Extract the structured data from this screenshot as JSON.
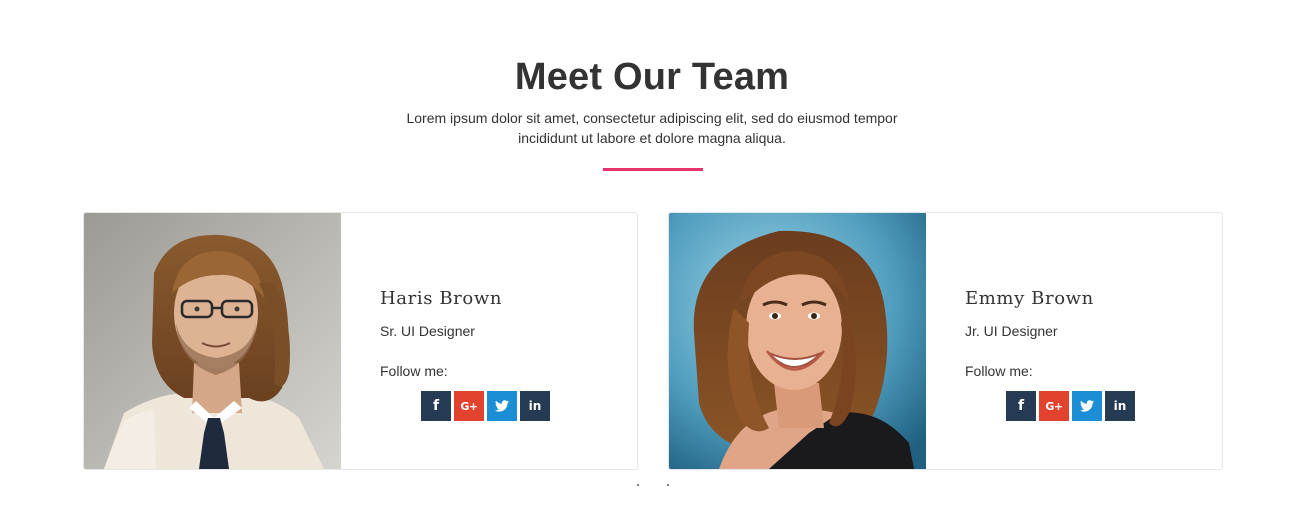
{
  "header": {
    "title": "Meet Our Team",
    "subtitle_line1": "Lorem ipsum dolor sit amet, consectetur adipiscing elit, sed do eiusmod tempor",
    "subtitle_line2": "incididunt ut labore et dolore magna aliqua.",
    "accent_color": "#e8336d"
  },
  "team": [
    {
      "name": "Haris Brown",
      "role": "Sr. UI Designer",
      "follow_label": "Follow me:",
      "socials": {
        "facebook": "f",
        "google_plus": "G+",
        "twitter": "twitter-icon",
        "linkedin": "in"
      }
    },
    {
      "name": "Emmy Brown",
      "role": "Jr. UI Designer",
      "follow_label": "Follow me:",
      "socials": {
        "facebook": "f",
        "google_plus": "G+",
        "twitter": "twitter-icon",
        "linkedin": "in"
      }
    }
  ],
  "colors": {
    "facebook": "#253b53",
    "google_plus": "#e2432f",
    "twitter": "#1c8ed6",
    "linkedin": "#253b53"
  }
}
